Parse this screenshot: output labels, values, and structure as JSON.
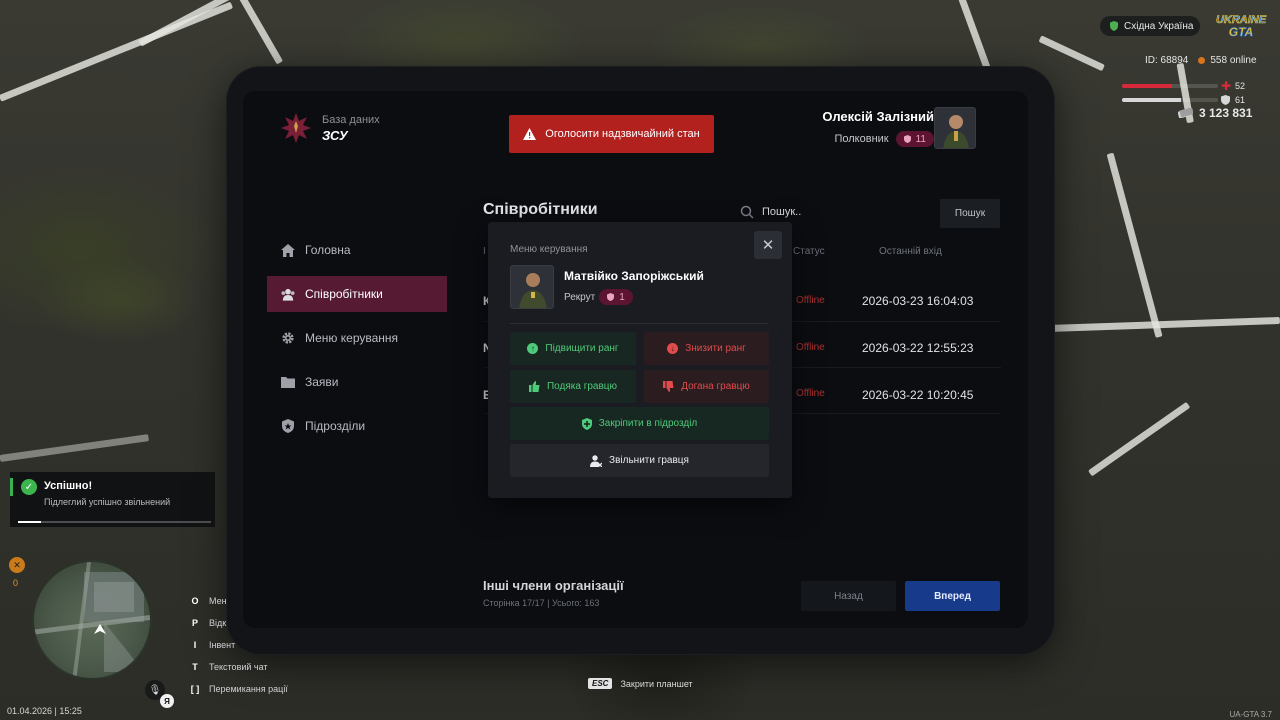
{
  "hud": {
    "region": "Східна Україна",
    "logo_text": "UKRAINE GTA",
    "id_text": "ID: 68894",
    "online_text": "558 online",
    "health": 52,
    "armor": 61,
    "health_value": "52",
    "armor_value": "61",
    "money": "3 123 831",
    "datetime": "01.04.2026 | 15:25",
    "version": "UA-GTA 3.7",
    "side_counter": "0",
    "voice_badge": "Я",
    "esc_key": "ESC",
    "esc_label": "Закрити планшет",
    "keybinds": [
      {
        "key": "O",
        "label": "Мен"
      },
      {
        "key": "P",
        "label": "Відк"
      },
      {
        "key": "I",
        "label": "Інвент"
      },
      {
        "key": "T",
        "label": "Текстовий чат"
      },
      {
        "key": "[   ]",
        "label": "Перемикання рації"
      }
    ],
    "colors": {
      "health": "#d8293a",
      "armor": "#d7d7d7",
      "accent": "#561a33",
      "primary": "#173a8a"
    }
  },
  "toast": {
    "title": "Успішно!",
    "text": "Підлеглий успішно звільнений",
    "progress": 0.12
  },
  "tablet": {
    "header": {
      "db_label": "База даних",
      "db_name": "ЗСУ",
      "alert_button": "Оголосити надзвичайний стан",
      "user_name": "Олексій Залізний",
      "user_rank": "Полковник",
      "user_rank_level": "11"
    },
    "nav": [
      {
        "label": "Головна",
        "icon": "home-icon"
      },
      {
        "label": "Співробітники",
        "icon": "users-icon",
        "active": true
      },
      {
        "label": "Меню керування",
        "icon": "gear-icon"
      },
      {
        "label": "Заяви",
        "icon": "folder-icon"
      },
      {
        "label": "Підрозділи",
        "icon": "shield-icon"
      }
    ],
    "employees": {
      "title": "Співробітники",
      "search_placeholder": "Пошук..",
      "search_button": "Пошук",
      "col_id": "І",
      "col_status": "Статус",
      "col_last_login": "Останній вхід",
      "rows": [
        {
          "name_initial": "К",
          "status": "Offline",
          "last_login": "2026-03-23 16:04:03"
        },
        {
          "name_initial": "N",
          "status": "Offline",
          "last_login": "2026-03-22 12:55:23"
        },
        {
          "name_initial": "Е",
          "status": "Offline",
          "last_login": "2026-03-22 10:20:45"
        }
      ]
    },
    "others": {
      "title": "Інші члени організації",
      "page_info": "Сторінка 17/17 | Усього: 163",
      "back_button": "Назад",
      "next_button": "Вперед"
    }
  },
  "modal": {
    "label": "Меню керування",
    "name": "Матвійко Запоріжський",
    "rank": "Рекрут",
    "rank_level": "1",
    "promote": "Підвищити ранг",
    "demote": "Знизити ранг",
    "thank": "Подяка гравцю",
    "reprimand": "Догана гравцю",
    "assign": "Закріпити в підрозділ",
    "dismiss": "Звільнити гравця"
  }
}
